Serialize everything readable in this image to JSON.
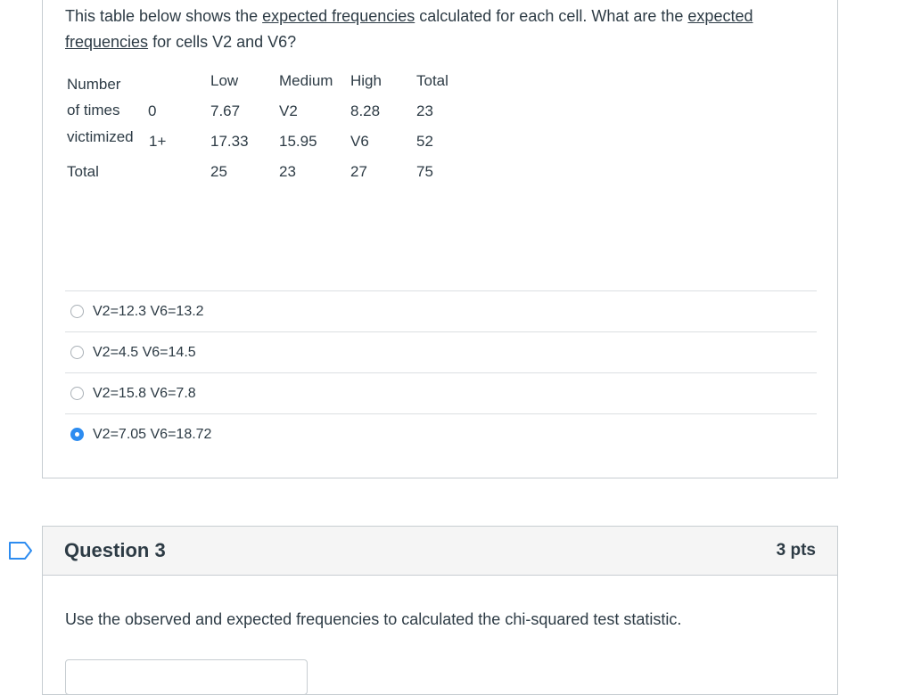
{
  "question2": {
    "text_parts": [
      "This table below shows the ",
      "expected frequencies",
      " calculated for each cell. What are the ",
      "expected frequencies",
      " for cells V2 and V6?"
    ],
    "table": {
      "row_header_lines": [
        "Number",
        "of times",
        "victimized"
      ],
      "headers": [
        "Low",
        "Medium",
        "High",
        "Total"
      ],
      "rows": [
        {
          "label": "0",
          "values": [
            "7.67",
            "V2",
            "8.28",
            "23"
          ]
        },
        {
          "label": "1+",
          "values": [
            "17.33",
            "15.95",
            "V6",
            "52"
          ]
        },
        {
          "label": "Total",
          "values": [
            "25",
            "23",
            "27",
            "75"
          ]
        }
      ]
    },
    "answers": [
      {
        "label": "V2=12.3 V6=13.2",
        "selected": false
      },
      {
        "label": "V2=4.5 V6=14.5",
        "selected": false
      },
      {
        "label": "V2=15.8 V6=7.8",
        "selected": false
      },
      {
        "label": "V2=7.05 V6=18.72",
        "selected": true
      }
    ]
  },
  "question3": {
    "title": "Question 3",
    "points": "3 pts",
    "text": "Use the observed and expected frequencies to calculated the chi-squared test statistic.",
    "answer_value": ""
  },
  "colors": {
    "accent": "#2d8cf0",
    "text": "#2d3b45",
    "border": "#c7cdd1"
  },
  "icons": {
    "bookmark": "bookmark-flag-icon"
  }
}
